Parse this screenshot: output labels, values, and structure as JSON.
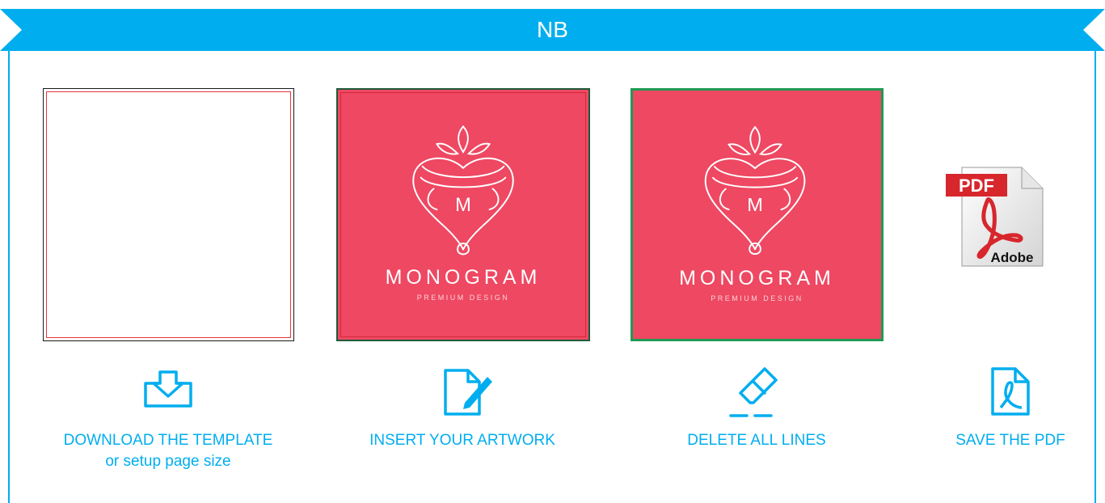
{
  "header": {
    "title": "NB"
  },
  "tiles": {
    "artwork_title": "MONOGRAM",
    "artwork_subtitle": "PREMIUM DESIGN",
    "artwork_initial": "M",
    "pdf_badge": "PDF",
    "pdf_brand": "Adobe"
  },
  "steps": [
    {
      "label": "DOWNLOAD THE TEMPLATE",
      "sublabel": "or setup page size",
      "icon": "download-icon"
    },
    {
      "label": "INSERT YOUR ARTWORK",
      "icon": "edit-document-icon"
    },
    {
      "label": "DELETE ALL LINES",
      "icon": "eraser-icon"
    },
    {
      "label": "SAVE THE PDF",
      "icon": "pdf-document-icon"
    }
  ],
  "colors": {
    "accent": "#00aeef",
    "artwork_bg": "#ee4862",
    "bleed_line": "#e8343e",
    "selection_green": "#1f9a54"
  }
}
